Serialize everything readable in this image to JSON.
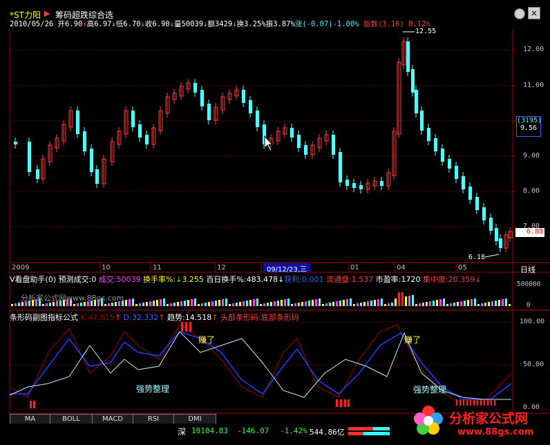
{
  "window": {
    "stock_name": "*ST力阳",
    "formula_name": "筹码超跌综合选",
    "settings_icon": "gear-icon",
    "close_glyph": "×"
  },
  "quote": {
    "date": "2010/05/26",
    "open_label": "开",
    "open": "6.90",
    "high_label": "高",
    "high": "6.97",
    "low_label": "低",
    "low": "6.70",
    "close_label": "收",
    "close": "6.90",
    "volume_label": "量",
    "volume": "50039",
    "amount_label": "额",
    "amount": "3429",
    "turnover_label": "换",
    "turnover": "3.25%",
    "amplitude_label": "振",
    "amplitude": "3.87%",
    "change_label": "涨",
    "change": "(-0.07)-1.00%",
    "index_label": "指数",
    "index_value": "(3.16)",
    "index_pct": "0.12%"
  },
  "price_axis": {
    "ticks": [
      "12.00",
      "11.00",
      "10.00",
      "9.00",
      "8.00",
      "7.00"
    ],
    "highlight_value": "9.56",
    "highlight_code": "(3195)",
    "current_price_tag": "6.88",
    "max_label": "12.55",
    "min_label": "6.18"
  },
  "date_axis": {
    "labels": [
      "2009",
      "10",
      "11",
      "12",
      "01",
      "04",
      "05"
    ],
    "cursor_date": "09/12/23,三",
    "period_button": "日线"
  },
  "volume_panel": {
    "title": "V看盘助手(0)",
    "predict_label": "预测成交:",
    "predict_value": "0",
    "vol_label": "成交:",
    "vol_value": "50039",
    "turnover_label": "换手率%:",
    "turnover_value": "3.255",
    "hundred_label": "百日换手%:",
    "hundred_value": "483.478",
    "gain_label": "获利:",
    "gain_value": "0.001",
    "float_label": "流通盘:",
    "float_value": "1.537",
    "pe_label": "市盈率:",
    "pe_value": "1720",
    "conc_label": "集中度:",
    "conc_value": "20.359",
    "watermark": "分析家公式网www.88gs.com",
    "axis_top": "500000",
    "axis_bottom": "0"
  },
  "indicator_panel": {
    "title": "条形码副图指标公式",
    "k_label": "K:",
    "k_value": "47.815",
    "d_label": "D:",
    "d_value": "32.332",
    "trend_label": "趋势:",
    "trend_value": "14.518",
    "head_label": "头部条形码:",
    "head_value": "底部条形码",
    "axis": [
      "100.00",
      "50.00",
      "0.00"
    ],
    "annotations": {
      "earn1": "赚了",
      "earn2": "赚了",
      "strong1": "强势整理",
      "strong2": "强势整理"
    }
  },
  "tabs": [
    "MA",
    "BOLL",
    "MACD",
    "RSI",
    "DMI"
  ],
  "status": {
    "market": "深",
    "index": "10104.83",
    "change": "-146.07",
    "pct": "-1.42%",
    "amount": "544.86亿"
  },
  "logo": {
    "text": "分析家公式网",
    "url": "www.88gs.com"
  },
  "colors": {
    "up": "#ff3c3c",
    "down": "#54ffff",
    "grid": "#8b0000",
    "k_line": "#a00000",
    "d_line": "#2040ff",
    "trend_line": "#c0f0ff"
  }
}
